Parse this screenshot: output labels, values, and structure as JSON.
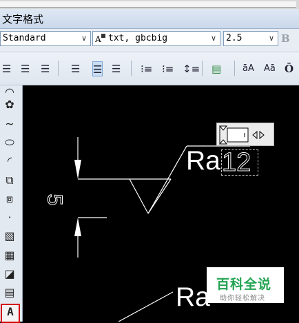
{
  "window": {
    "title": "文字格式"
  },
  "toolbar1": {
    "style_value": "Standard",
    "font_value": "txt, gbcbig",
    "height_value": "2.5",
    "bold_label": "B"
  },
  "toolbar2": {
    "superscript_label": "āA",
    "subscript_label": "Aā"
  },
  "drawing": {
    "ra_label_1": "Ra",
    "ra_label_2": "Ra",
    "value_text": "12",
    "dimension_text": "5"
  },
  "watermark": {
    "title": "百科全说",
    "subtitle": "助你轻松解决"
  },
  "colors": {
    "accent": "#d40000",
    "brand": "#22a352"
  }
}
